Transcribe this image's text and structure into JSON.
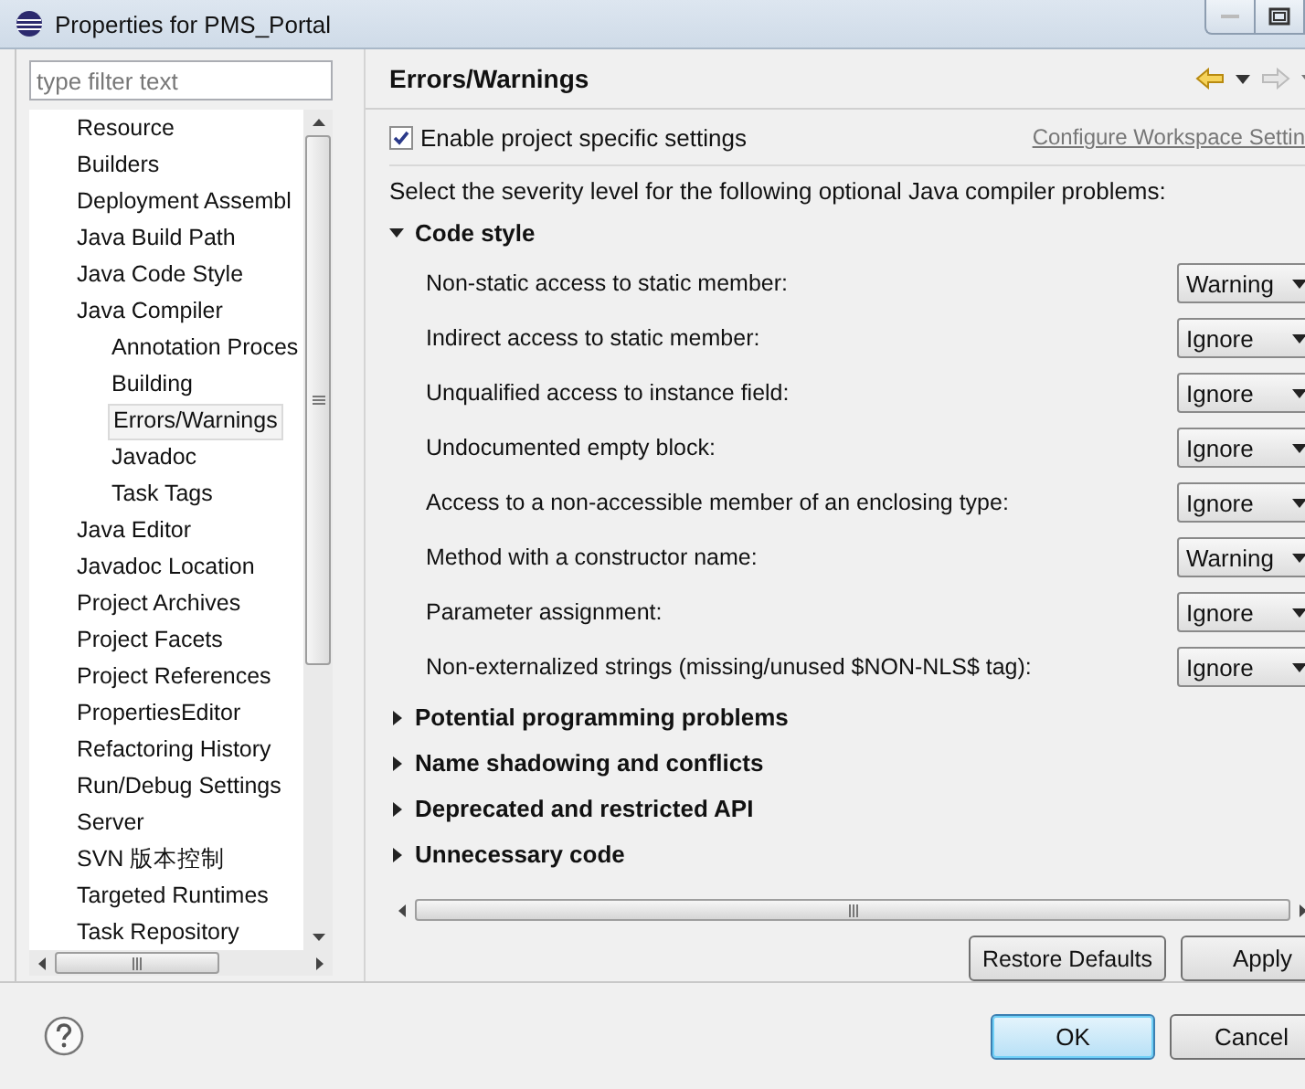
{
  "window": {
    "title": "Properties for PMS_Portal"
  },
  "filter": {
    "placeholder": "type filter text"
  },
  "tree": [
    {
      "label": "Resource",
      "selected": false
    },
    {
      "label": "Builders",
      "selected": false
    },
    {
      "label": "Deployment Assembl",
      "selected": false
    },
    {
      "label": "Java Build Path",
      "selected": false
    },
    {
      "label": "Java Code Style",
      "selected": false
    },
    {
      "label": "Java Compiler",
      "selected": false,
      "children": [
        {
          "label": "Annotation Proces",
          "selected": false
        },
        {
          "label": "Building",
          "selected": false
        },
        {
          "label": "Errors/Warnings",
          "selected": true
        },
        {
          "label": "Javadoc",
          "selected": false
        },
        {
          "label": "Task Tags",
          "selected": false
        }
      ]
    },
    {
      "label": "Java Editor",
      "selected": false
    },
    {
      "label": "Javadoc Location",
      "selected": false
    },
    {
      "label": "Project Archives",
      "selected": false
    },
    {
      "label": "Project Facets",
      "selected": false
    },
    {
      "label": "Project References",
      "selected": false
    },
    {
      "label": "PropertiesEditor",
      "selected": false
    },
    {
      "label": "Refactoring History",
      "selected": false
    },
    {
      "label": "Run/Debug Settings",
      "selected": false
    },
    {
      "label": "Server",
      "selected": false
    },
    {
      "label": "SVN 版本控制",
      "selected": false
    },
    {
      "label": "Targeted Runtimes",
      "selected": false
    },
    {
      "label": "Task Repository",
      "selected": false
    }
  ],
  "page": {
    "title": "Errors/Warnings",
    "enable_specific": {
      "label": "Enable project specific settings",
      "checked": true
    },
    "configure_link": "Configure Workspace Settin",
    "description": "Select the severity level for the following optional Java compiler problems:",
    "sections": [
      {
        "title": "Code style",
        "expanded": true,
        "options": [
          {
            "label": "Non-static access to static member:",
            "value": "Warning"
          },
          {
            "label": "Indirect access to static member:",
            "value": "Ignore"
          },
          {
            "label": "Unqualified access to instance field:",
            "value": "Ignore"
          },
          {
            "label": "Undocumented empty block:",
            "value": "Ignore"
          },
          {
            "label": "Access to a non-accessible member of an enclosing type:",
            "value": "Ignore"
          },
          {
            "label": "Method with a constructor name:",
            "value": "Warning"
          },
          {
            "label": "Parameter assignment:",
            "value": "Ignore"
          },
          {
            "label": "Non-externalized strings (missing/unused $NON-NLS$ tag):",
            "value": "Ignore"
          }
        ]
      },
      {
        "title": "Potential programming problems",
        "expanded": false
      },
      {
        "title": "Name shadowing and conflicts",
        "expanded": false
      },
      {
        "title": "Deprecated and restricted API",
        "expanded": false
      },
      {
        "title": "Unnecessary code",
        "expanded": false
      }
    ]
  },
  "page_buttons": [
    "Restore Defaults",
    "Apply"
  ],
  "dialog_buttons": [
    {
      "label": "OK",
      "default": true
    },
    {
      "label": "Cancel",
      "default": false
    }
  ]
}
